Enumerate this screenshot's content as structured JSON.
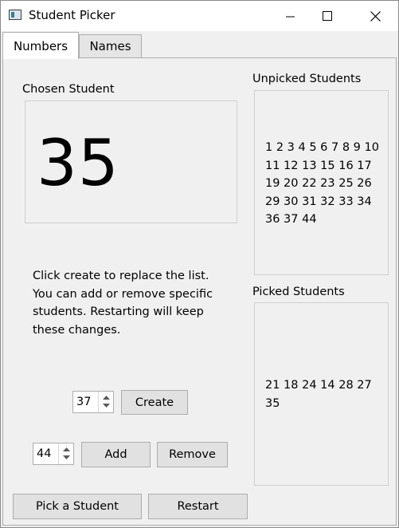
{
  "window": {
    "title": "Student Picker"
  },
  "tabs": [
    {
      "label": "Numbers",
      "active": true
    },
    {
      "label": "Names",
      "active": false
    }
  ],
  "chosen": {
    "label": "Chosen Student",
    "value": "35"
  },
  "unpicked": {
    "label": "Unpicked Students",
    "text": "1 2 3 4 5 6 7 8 9 10 11 12 13 15 16 17 19 20 22 23 25 26 29 30 31 32 33 34 36 37 44"
  },
  "picked": {
    "label": "Picked Students",
    "text": "21 18 24 14 28 27 35"
  },
  "info_text": "Click create to replace the list. You can add or remove specific students. Restarting will keep these changes.",
  "create_row": {
    "spinner_value": "37",
    "button_label": "Create"
  },
  "edit_row": {
    "spinner_value": "44",
    "add_label": "Add",
    "remove_label": "Remove"
  },
  "footer": {
    "pick_label": "Pick a Student",
    "restart_label": "Restart"
  },
  "colors": {
    "window_bg": "#f0f0f0",
    "button_bg": "#e1e1e1",
    "border": "#adadad"
  }
}
